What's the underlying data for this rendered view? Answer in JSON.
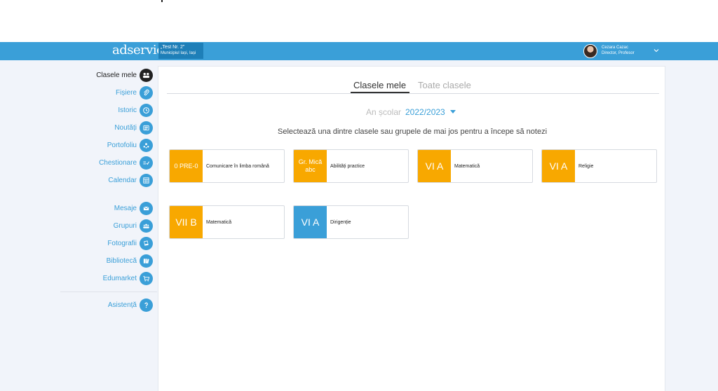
{
  "header": {
    "logo": "adservio",
    "school_name": "„Test Nr. 2\"",
    "school_city": "Municipiul Iași, Iași",
    "user_name": "Cezara Cazac",
    "user_role": "Director, Profesor"
  },
  "sidebar": {
    "items": [
      {
        "label": "Clasele mele",
        "icon": "users-icon"
      },
      {
        "label": "Fișiere",
        "icon": "paperclip-icon"
      },
      {
        "label": "Istoric",
        "icon": "history-icon"
      },
      {
        "label": "Noutăți",
        "icon": "news-icon"
      },
      {
        "label": "Portofoliu",
        "icon": "portfolio-icon"
      },
      {
        "label": "Chestionare",
        "icon": "questionnaire-icon"
      },
      {
        "label": "Calendar",
        "icon": "calendar-icon"
      },
      {
        "label": "Mesaje",
        "icon": "mail-icon"
      },
      {
        "label": "Grupuri",
        "icon": "groups-icon"
      },
      {
        "label": "Fotografii",
        "icon": "photos-icon"
      },
      {
        "label": "Bibliotecă",
        "icon": "library-icon"
      },
      {
        "label": "Edumarket",
        "icon": "cart-icon"
      },
      {
        "label": "Asistență",
        "icon": "help-icon"
      }
    ]
  },
  "main": {
    "tabs": [
      {
        "label": "Clasele mele",
        "active": true
      },
      {
        "label": "Toate clasele",
        "active": false
      }
    ],
    "year_label": "An școlar",
    "year_value": "2022/2023",
    "instructions": "Selectează una dintre clasele sau grupele de mai jos pentru a începe să notezi",
    "cards": [
      {
        "class": "0 PRE-0",
        "subject": "Comunicare în limba română",
        "color": "#f8a800"
      },
      {
        "class": "Gr. Mică abc",
        "subject": "Abilități practice",
        "color": "#f8a800"
      },
      {
        "class": "VI A",
        "subject": "Matematică",
        "color": "#f8a800"
      },
      {
        "class": "VI A",
        "subject": "Religie",
        "color": "#f8a800"
      },
      {
        "class": "VII B",
        "subject": "Matematică",
        "color": "#f8a800"
      },
      {
        "class": "VI A",
        "subject": "Dirigenție",
        "color": "#3a9fd8"
      }
    ]
  },
  "colors": {
    "brand_blue": "#3a9fd8",
    "dark_blue": "#1e7fb8",
    "orange": "#f8a800"
  }
}
